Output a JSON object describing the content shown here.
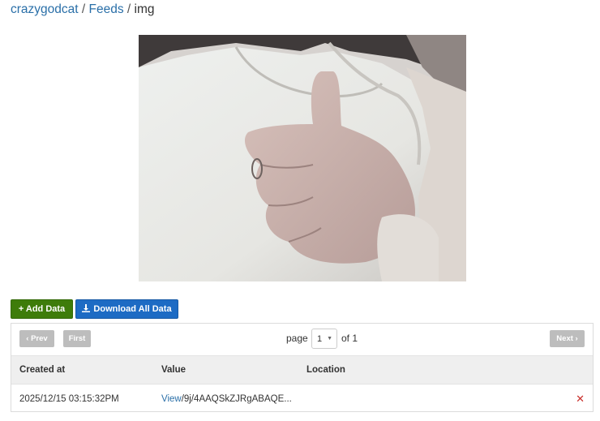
{
  "breadcrumb": {
    "user": "crazygodcat",
    "sep1": " / ",
    "feeds": "Feeds",
    "sep2": " / ",
    "current": "img"
  },
  "image": {
    "alt": "Webcam photo of a thumbs up"
  },
  "actions": {
    "add_label": "+ Add Data",
    "download_label": "Download All Data"
  },
  "pager": {
    "prev_label": "Prev",
    "first_label": "First",
    "next_label": "Next",
    "page_label": "page",
    "page_value": "1",
    "of_label": "of 1"
  },
  "table": {
    "headers": [
      "Created at",
      "Value",
      "Location"
    ],
    "rows": [
      {
        "created_at": "2025/12/15 03:15:32PM",
        "view_label": "View",
        "value": "/9j/4AAQSkZJRgABAQE...",
        "location": ""
      }
    ]
  },
  "colors": {
    "link": "#2a6fa8",
    "add_button": "#3e7c0a",
    "download_button": "#1d6bc4",
    "delete": "#c9302c"
  }
}
